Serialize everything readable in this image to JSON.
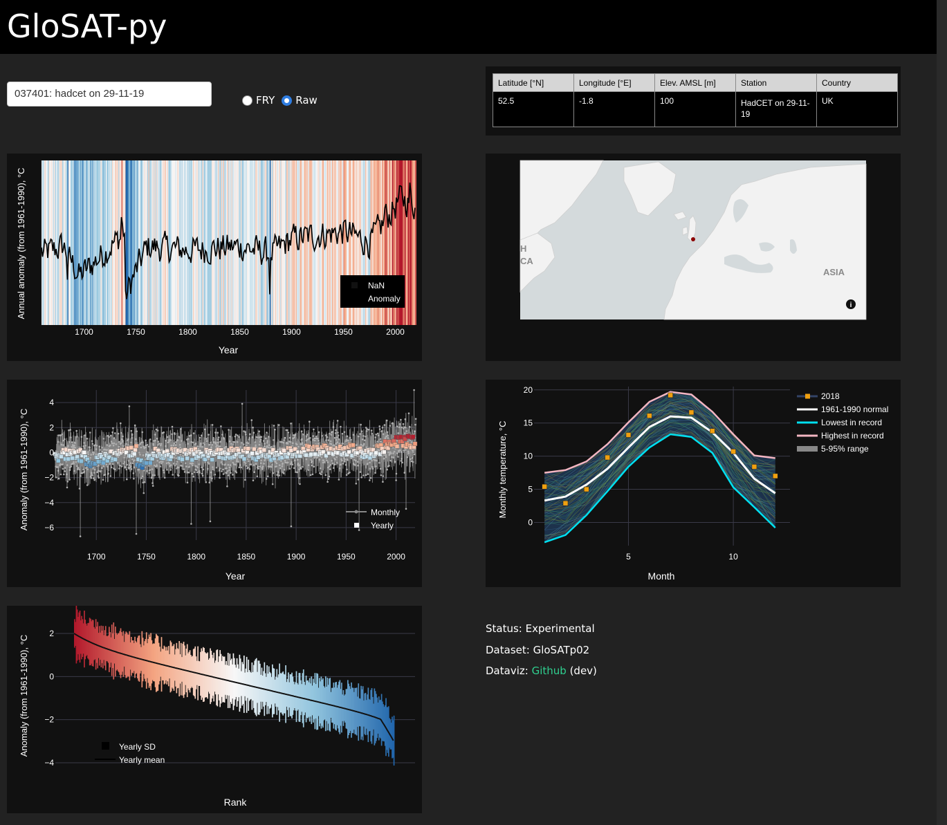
{
  "app": {
    "title": "GloSAT-py"
  },
  "station_select": {
    "value": "037401: hadcet on 29-11-19"
  },
  "radio": {
    "options": [
      "FRY",
      "Raw"
    ],
    "selected": "Raw"
  },
  "info_table": {
    "headers": [
      "Latitude [°N]",
      "Longitude [°E]",
      "Elev. AMSL [m]",
      "Station",
      "Country"
    ],
    "row": [
      "52.5",
      "-1.8",
      "100",
      "HadCET on 29-11-19",
      "UK"
    ]
  },
  "map": {
    "label_asia": "ASIA",
    "label_partial_1": "H",
    "label_partial_2": "CA",
    "marker_color": "#8b0000"
  },
  "colors": {
    "warm": "#b2182b",
    "cool": "#2166ac",
    "background": "#222222",
    "panel": "#111111"
  },
  "footer": {
    "status_label": "Status:",
    "status_value": "Experimental",
    "dataset_label": "Dataset:",
    "dataset_value": "GloSATp02",
    "dataviz_label": "Dataviz:",
    "dataviz_link": "Github",
    "dataviz_suffix": "(dev)"
  },
  "chart_data": [
    {
      "type": "bar",
      "name_hint": "stripes",
      "xlabel": "Year",
      "ylabel": "Annual anomaly (from 1961-1990), °C",
      "xlim": [
        1659,
        2019
      ],
      "ylim": [
        -2.2,
        2.2
      ],
      "xticks": [
        1700,
        1750,
        1800,
        1850,
        1900,
        1950,
        2000
      ],
      "legend": [
        "NaN",
        "Anomaly"
      ],
      "legend_position": "bottom-right",
      "anomaly_keyframes": [
        [
          1659,
          -0.3
        ],
        [
          1680,
          -0.1
        ],
        [
          1695,
          -0.9
        ],
        [
          1740,
          0.3
        ],
        [
          1741,
          -1.3
        ],
        [
          1760,
          -0.1
        ],
        [
          1800,
          -0.2
        ],
        [
          1850,
          -0.1
        ],
        [
          1880,
          -0.3
        ],
        [
          1900,
          0.1
        ],
        [
          1950,
          0.3
        ],
        [
          1975,
          0.0
        ],
        [
          1990,
          0.6
        ],
        [
          2005,
          1.2
        ],
        [
          2019,
          1.0
        ]
      ],
      "anomaly_extremes": [
        [
          1740,
          -2.1
        ],
        [
          1879,
          -1.9
        ],
        [
          1684,
          -1.3
        ],
        [
          1736,
          1.0
        ],
        [
          1990,
          1.1
        ],
        [
          2014,
          1.9
        ]
      ]
    },
    {
      "type": "scatter",
      "xlabel": "Year",
      "ylabel": "Anomaly (from 1961-1990), °C",
      "xlim": [
        1659,
        2019
      ],
      "ylim": [
        -7,
        5
      ],
      "xticks": [
        1700,
        1750,
        1800,
        1850,
        1900,
        1950,
        2000
      ],
      "yticks": [
        4,
        2,
        0,
        -2,
        -4,
        -6
      ],
      "legend": [
        "Monthly",
        "Yearly"
      ],
      "legend_position": "bottom-right",
      "monthly_spread": 2.0,
      "monthly_extremes": [
        [
          1684,
          -6.7
        ],
        [
          1740,
          -6.5
        ],
        [
          1795,
          -5.7
        ],
        [
          1814,
          -5.5
        ],
        [
          1895,
          -5.9
        ],
        [
          1963,
          -6.2
        ],
        [
          2010,
          -4.5
        ],
        [
          2018,
          5.0
        ],
        [
          1846,
          3.9
        ],
        [
          1733,
          3.7
        ]
      ]
    },
    {
      "type": "line",
      "xlabel": "Month",
      "ylabel": "Monthly temperature, °C",
      "xlim": [
        0.5,
        12.7
      ],
      "ylim": [
        -3.5,
        20.5
      ],
      "xticks": [
        5,
        10
      ],
      "yticks": [
        20,
        15,
        10,
        5,
        0
      ],
      "series": [
        {
          "name": "2018",
          "x": [
            1,
            2,
            3,
            4,
            5,
            6,
            7,
            8,
            9,
            10,
            11,
            12
          ],
          "values": [
            5.4,
            2.9,
            5.0,
            9.8,
            13.2,
            16.1,
            19.2,
            16.6,
            13.8,
            10.7,
            8.4,
            7.0
          ],
          "color": "#f0a010"
        },
        {
          "name": "1961-1990 normal",
          "x": [
            1,
            2,
            3,
            4,
            5,
            6,
            7,
            8,
            9,
            10,
            11,
            12
          ],
          "values": [
            3.3,
            3.9,
            5.7,
            8.1,
            11.3,
            14.4,
            16.0,
            15.8,
            13.6,
            10.5,
            6.6,
            4.4
          ],
          "color": "#ffffff"
        },
        {
          "name": "Lowest in record",
          "x": [
            1,
            2,
            3,
            4,
            5,
            6,
            7,
            8,
            9,
            10,
            11,
            12
          ],
          "values": [
            -3.0,
            -1.9,
            1.1,
            4.7,
            8.4,
            11.3,
            13.3,
            12.9,
            10.5,
            5.3,
            2.3,
            -0.8
          ],
          "color": "#00e0f0"
        },
        {
          "name": "Highest in record",
          "x": [
            1,
            2,
            3,
            4,
            5,
            6,
            7,
            8,
            9,
            10,
            11,
            12
          ],
          "values": [
            7.5,
            7.9,
            9.2,
            11.8,
            15.1,
            18.2,
            19.7,
            19.3,
            16.7,
            13.3,
            10.1,
            9.7
          ],
          "color": "#f4b6c2"
        },
        {
          "name": "5-95% range",
          "color": "#888888"
        }
      ]
    },
    {
      "type": "bar",
      "name_hint": "rank",
      "xlabel": "Rank",
      "ylabel": "Anomaly (from 1961-1990), °C",
      "ylim": [
        -4.8,
        2.8
      ],
      "yticks": [
        2,
        0,
        -2,
        -4
      ],
      "legend": [
        "Yearly SD",
        "Yearly mean"
      ],
      "legend_position": "bottom-left",
      "count": 361,
      "mean_range": [
        1.5,
        -2.0
      ],
      "sd_typical": 0.9
    }
  ]
}
